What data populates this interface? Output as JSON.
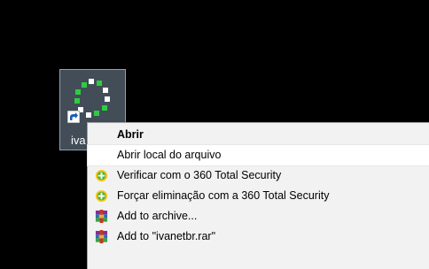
{
  "desktop": {
    "shortcut": {
      "label": "iva"
    }
  },
  "context_menu": {
    "items": [
      {
        "label": "Abrir",
        "icon": "",
        "default": true
      },
      {
        "label": "Abrir local do arquivo",
        "icon": "",
        "highlighted": true
      },
      {
        "label": "Verificar com o 360 Total Security",
        "icon": "360-total-security-icon"
      },
      {
        "label": "Forçar eliminação com a 360 Total Security",
        "icon": "360-total-security-icon"
      },
      {
        "label": "Add to archive...",
        "icon": "winrar-icon"
      },
      {
        "label": "Add to \"ivanetbr.rar\"",
        "icon": "winrar-icon"
      }
    ]
  },
  "colors": {
    "desktop_background": "#000000",
    "menu_background": "#f2f2f2",
    "menu_highlight": "#ffffff",
    "icon_green": "#2ecc40"
  }
}
